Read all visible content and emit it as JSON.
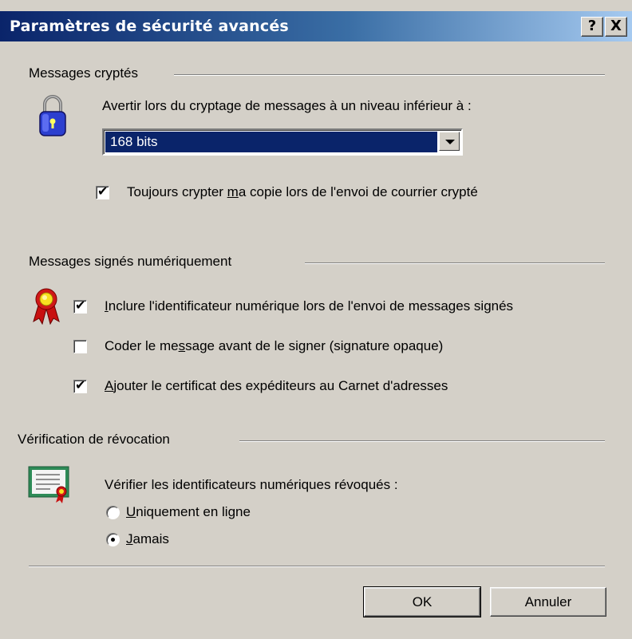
{
  "window": {
    "title": "Paramètres de sécurité avancés",
    "help_label": "?",
    "close_label": "X"
  },
  "encrypted": {
    "group_label": "Messages cryptés",
    "warn_label": "Avertir lors du cryptage de messages à un niveau inférieur à :",
    "level_value": "168 bits",
    "always_encrypt_label": "Toujours crypter ma copie lors de l'envoi de courrier crypté",
    "always_encrypt_checked": true
  },
  "signed": {
    "group_label": "Messages signés numériquement",
    "include_id_label": "Inclure l'identificateur numérique lors de l'envoi de messages signés",
    "include_id_checked": true,
    "encode_label": "Coder le message avant de le signer (signature opaque)",
    "encode_checked": false,
    "add_cert_label": "Ajouter le certificat des expéditeurs au Carnet d'adresses",
    "add_cert_checked": true
  },
  "revocation": {
    "group_label": "Vérification de révocation",
    "check_label": "Vérifier les identificateurs numériques révoqués :",
    "options": [
      "Uniquement en ligne",
      "Jamais"
    ],
    "selected": "Jamais"
  },
  "buttons": {
    "ok": "OK",
    "cancel": "Annuler"
  },
  "colors": {
    "title_bar": "#0a246a",
    "dialog_bg": "#d4d0c8",
    "selection": "#0a246a"
  },
  "icons": [
    "padlock-icon",
    "award-ribbon-icon",
    "certificate-icon"
  ]
}
